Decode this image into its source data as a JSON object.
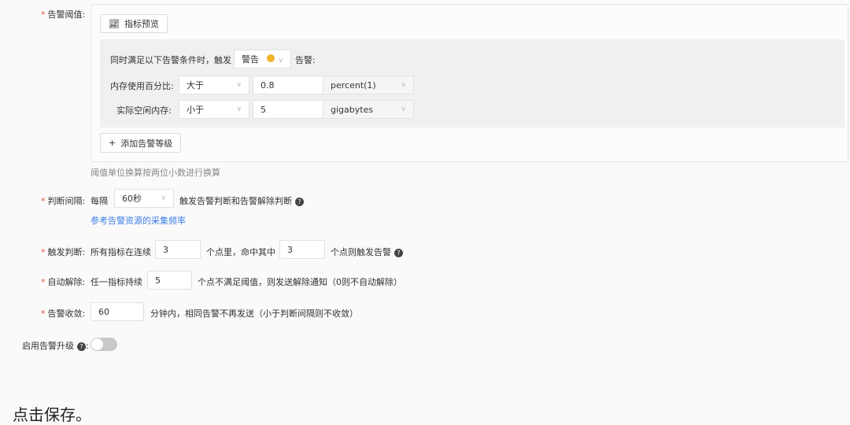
{
  "threshold": {
    "label": "告警阈值:",
    "preview_button": "指标预览",
    "condition_prefix": "同时满足以下告警条件时，触发",
    "level": "警告",
    "condition_suffix": "告警:",
    "rows": [
      {
        "metric": "内存使用百分比:",
        "op": "大于",
        "value": "0.8",
        "unit": "percent(1)"
      },
      {
        "metric": "实际空闲内存:",
        "op": "小于",
        "value": "5",
        "unit": "gigabytes"
      }
    ],
    "add_level_button": "添加告警等级",
    "hint": "阈值单位换算按两位小数进行换算"
  },
  "interval": {
    "label": "判断间隔:",
    "prefix": "每隔",
    "value": "60秒",
    "suffix": "触发告警判断和告警解除判断",
    "link": "参考告警资源的采集频率"
  },
  "trigger": {
    "label": "触发判断:",
    "prefix": "所有指标在连续",
    "points": "3",
    "middle": "个点里，命中其中",
    "hits": "3",
    "suffix": "个点则触发告警"
  },
  "auto_resolve": {
    "label": "自动解除:",
    "prefix": "任一指标持续",
    "value": "5",
    "suffix": "个点不满足阈值，则发送解除通知（0则不自动解除）"
  },
  "converge": {
    "label": "告警收敛:",
    "value": "60",
    "suffix": "分钟内，相同告警不再发送（小于判断间隔则不收敛）"
  },
  "escalation": {
    "label": "启用告警升级",
    "colon": ":",
    "enabled": false
  },
  "footer_text": "点击保存。"
}
